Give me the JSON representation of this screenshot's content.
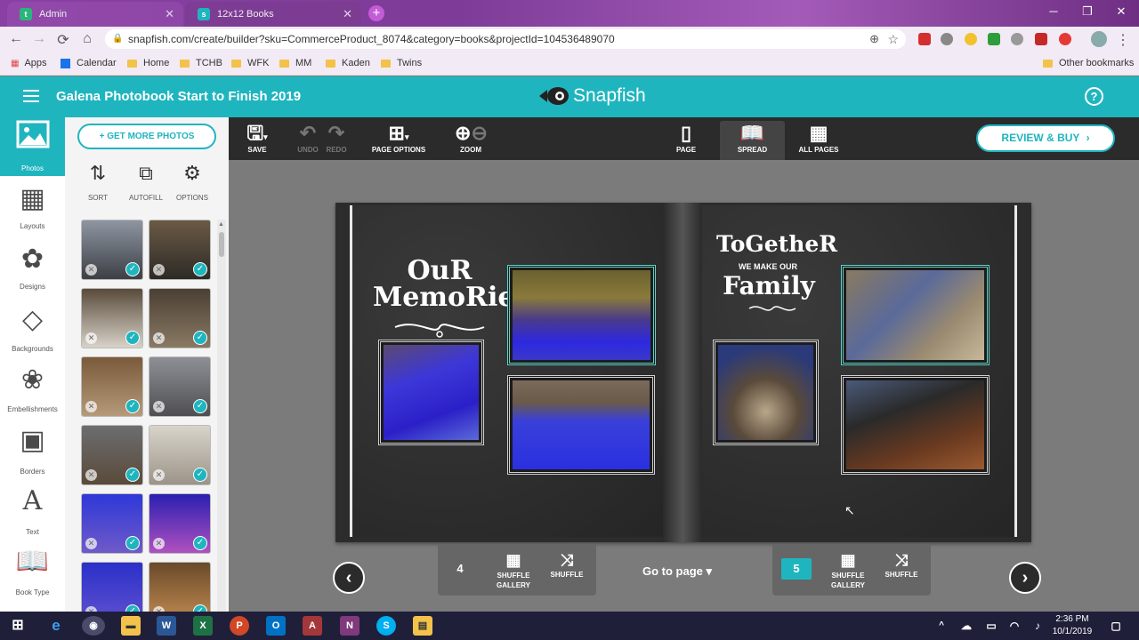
{
  "browser": {
    "tabs": [
      {
        "label": "Admin",
        "favicon": "t"
      },
      {
        "label": "12x12 Books",
        "favicon": "s"
      }
    ],
    "new_tab": "+",
    "window_controls": {
      "minimize": "─",
      "maximize": "❐",
      "close": "✕"
    },
    "url": "snapfish.com/create/builder?sku=CommerceProduct_8074&category=books&projectId=104536489070",
    "bookmarks": [
      "Apps",
      "Calendar",
      "Home",
      "TCHB",
      "WFK",
      "MM",
      "Kaden",
      "Twins"
    ],
    "other_bookmarks": "Other bookmarks",
    "nav": {
      "back": "←",
      "forward": "→",
      "reload": "⟳",
      "home": "⌂",
      "lock": "🔒",
      "zoom": "⊕",
      "star": "☆"
    }
  },
  "header": {
    "project_title": "Galena Photobook Start to Finish 2019",
    "logo_text": "Snapfish",
    "help": "?"
  },
  "left_rail": {
    "items": [
      {
        "label": "Photos",
        "icon": "🖼"
      },
      {
        "label": "Layouts",
        "icon": "▦"
      },
      {
        "label": "Designs",
        "icon": "✿"
      },
      {
        "label": "Backgrounds",
        "icon": "◇"
      },
      {
        "label": "Embellishments",
        "icon": "❀"
      },
      {
        "label": "Borders",
        "icon": "▣"
      },
      {
        "label": "Text",
        "icon": "A"
      },
      {
        "label": "Book Type",
        "icon": "📖"
      }
    ]
  },
  "panel": {
    "get_more": "+ GET MORE PHOTOS",
    "tools": [
      {
        "label": "SORT",
        "icon": "⇅"
      },
      {
        "label": "AUTOFILL",
        "icon": "⧉"
      },
      {
        "label": "OPTIONS",
        "icon": "⚙"
      }
    ],
    "thumbnails": [
      {
        "color_a": "#8e96a3",
        "color_b": "#3d3f44"
      },
      {
        "color_a": "#6b5a45",
        "color_b": "#2d2a26"
      },
      {
        "color_a": "#5a4b3b",
        "color_b": "#d8d2c8"
      },
      {
        "color_a": "#4b3f34",
        "color_b": "#8a7a64"
      },
      {
        "color_a": "#7a5a3a",
        "color_b": "#b59a7a"
      },
      {
        "color_a": "#8d9096",
        "color_b": "#4f4f52"
      },
      {
        "color_a": "#6c6d70",
        "color_b": "#5a4a3a"
      },
      {
        "color_a": "#d8d4cb",
        "color_b": "#9c9488"
      },
      {
        "color_a": "#2e38d8",
        "color_b": "#6f5ac8"
      },
      {
        "color_a": "#2a20b0",
        "color_b": "#b050c0"
      },
      {
        "color_a": "#2a30c8",
        "color_b": "#6050d0"
      },
      {
        "color_a": "#6a4a2a",
        "color_b": "#c08a50"
      }
    ],
    "check": "✓",
    "remove": "✕"
  },
  "toolbar": {
    "save": "SAVE",
    "undo": "UNDO",
    "redo": "REDO",
    "page_options": "PAGE OPTIONS",
    "zoom": "ZOOM",
    "page": "PAGE",
    "spread": "SPREAD",
    "all_pages": "ALL PAGES",
    "review_buy": "REVIEW & BUY"
  },
  "spread": {
    "left_title_1": "OuR",
    "left_title_2": "MemoRies",
    "right_title_1": "ToGetheR",
    "right_title_2": "WE MAKE OUR",
    "right_title_3": "Family"
  },
  "page_controls": {
    "left_page_number": "4",
    "right_page_number": "5",
    "shuffle_gallery": "SHUFFLE GALLERY",
    "shuffle": "SHUFFLE",
    "go_to_page": "Go to page ▾",
    "prev": "‹",
    "next": "›"
  },
  "taskbar": {
    "time": "2:36 PM",
    "date": "10/1/2019"
  }
}
